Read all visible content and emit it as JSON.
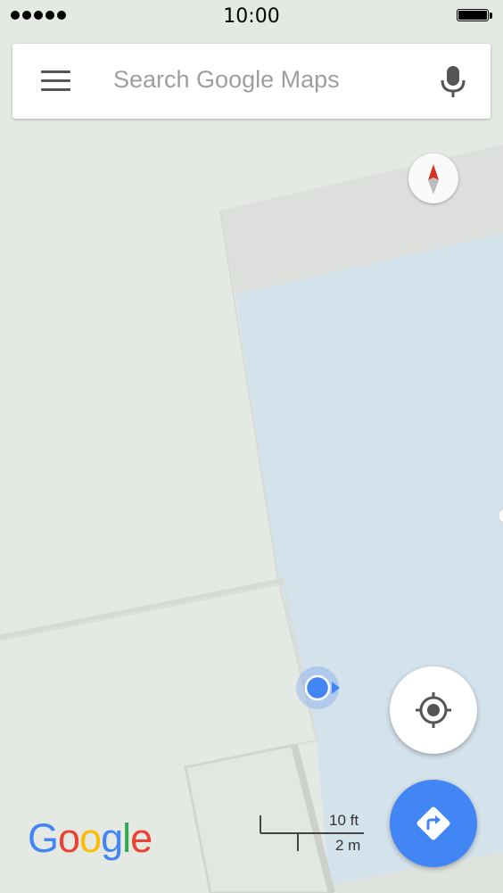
{
  "status_bar": {
    "time": "10:00",
    "signal_bars": 5
  },
  "search": {
    "placeholder": "Search Google Maps"
  },
  "icons": {
    "menu": "hamburger-menu-icon",
    "mic": "microphone-icon",
    "compass": "compass-icon",
    "locate": "my-location-icon",
    "directions": "directions-icon"
  },
  "map": {
    "scale_ft": "10 ft",
    "scale_m": "2 m",
    "colors": {
      "land": "#e5e9e4",
      "water": "#d4e2ec",
      "building_gray": "#dcdfdb",
      "blue_dot": "#4285f4",
      "directions_fab": "#4285f4"
    }
  },
  "logo": {
    "letters": [
      "G",
      "o",
      "o",
      "g",
      "l",
      "e"
    ],
    "colors": [
      "#4285f4",
      "#ea4335",
      "#fbbc05",
      "#4285f4",
      "#34a853",
      "#ea4335"
    ]
  }
}
